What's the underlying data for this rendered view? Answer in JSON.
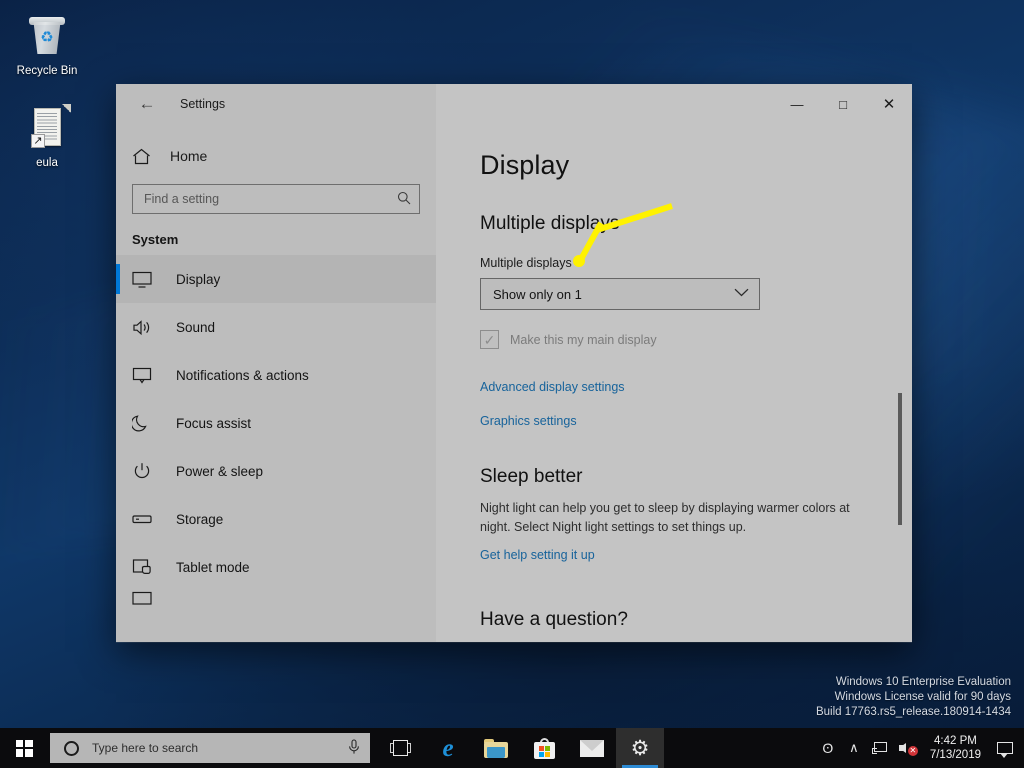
{
  "desktop": {
    "icons": [
      {
        "name": "Recycle Bin",
        "icon": "recycle-bin-icon"
      },
      {
        "name": "eula",
        "icon": "text-document-shortcut-icon"
      }
    ],
    "watermark": {
      "line1": "Windows 10 Enterprise Evaluation",
      "line2": "Windows License valid for 90 days",
      "line3": "Build 17763.rs5_release.180914-1434"
    }
  },
  "window": {
    "title": "Settings",
    "back_label": "←",
    "controls": {
      "minimize": "—",
      "maximize": "□",
      "close": "✕"
    }
  },
  "sidebar": {
    "home_label": "Home",
    "search": {
      "placeholder": "Find a setting",
      "value": "",
      "icon": "search-icon"
    },
    "group_title": "System",
    "items": [
      {
        "label": "Display",
        "icon": "monitor-icon",
        "selected": true
      },
      {
        "label": "Sound",
        "icon": "speaker-icon",
        "selected": false
      },
      {
        "label": "Notifications & actions",
        "icon": "notification-icon",
        "selected": false
      },
      {
        "label": "Focus assist",
        "icon": "moon-icon",
        "selected": false
      },
      {
        "label": "Power & sleep",
        "icon": "power-icon",
        "selected": false
      },
      {
        "label": "Storage",
        "icon": "drive-icon",
        "selected": false
      },
      {
        "label": "Tablet mode",
        "icon": "tablet-icon",
        "selected": false
      }
    ]
  },
  "content": {
    "page_title": "Display",
    "multiple_displays": {
      "section_heading": "Multiple displays",
      "field_label": "Multiple displays",
      "dropdown_value": "Show only on 1",
      "dropdown_chevron": "⌄",
      "checkbox_label": "Make this my main display",
      "checkbox_checked": true,
      "checkbox_disabled": true,
      "checkbox_glyph": "✓"
    },
    "links": {
      "advanced_display_settings": "Advanced display settings",
      "graphics_settings": "Graphics settings",
      "get_help": "Get help setting it up"
    },
    "sleep_better": {
      "heading": "Sleep better",
      "body": "Night light can help you get to sleep by displaying warmer colors at night. Select Night light settings to set things up."
    },
    "have_a_question": "Have a question?"
  },
  "callout": {
    "text": "Multiple displays",
    "border_color": "#fff200",
    "fill_color": "#ffffff"
  },
  "taskbar": {
    "start": "start-button",
    "search": {
      "placeholder": "Type here to search",
      "value": "",
      "mic_icon": "microphone-icon"
    },
    "apps": [
      {
        "name": "task-view",
        "icon": "task-view-icon",
        "active": false
      },
      {
        "name": "microsoft-edge",
        "icon": "edge-icon",
        "active": false
      },
      {
        "name": "file-explorer",
        "icon": "folder-icon",
        "active": false
      },
      {
        "name": "microsoft-store",
        "icon": "store-icon",
        "active": false
      },
      {
        "name": "mail",
        "icon": "mail-icon",
        "active": false
      },
      {
        "name": "settings",
        "icon": "gear-icon",
        "active": true
      }
    ],
    "tray": {
      "people": "ʘ",
      "chevron": "∧",
      "network_icon": "network-icon",
      "volume_icon": "volume-muted-icon",
      "volume_badge": "✕",
      "time": "4:42 PM",
      "date": "7/13/2019",
      "action_center": "action-center-icon"
    }
  },
  "colors": {
    "accent": "#0078d7",
    "link": "#17639b",
    "highlight": "#fff200",
    "window_bg": "#c4c4c4",
    "sidebar_bg": "#bdbdbd"
  }
}
